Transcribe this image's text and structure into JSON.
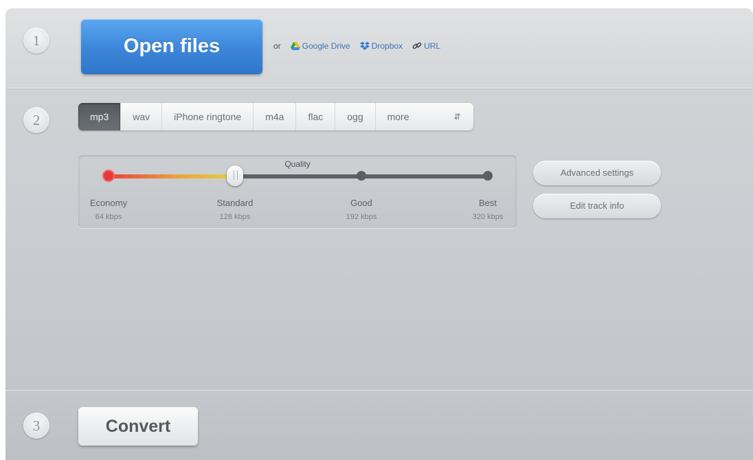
{
  "steps": [
    "1",
    "2",
    "3"
  ],
  "open": {
    "label": "Open files",
    "or": "or",
    "sources": [
      {
        "label": "Google Drive",
        "icon": "google-drive-icon"
      },
      {
        "label": "Dropbox",
        "icon": "dropbox-icon"
      },
      {
        "label": "URL",
        "icon": "link-icon"
      }
    ]
  },
  "formats": {
    "tabs": [
      "mp3",
      "wav",
      "iPhone ringtone",
      "m4a",
      "flac",
      "ogg",
      "more"
    ],
    "selected": "mp3"
  },
  "quality": {
    "label": "Quality",
    "selected_index": 1,
    "levels": [
      {
        "name": "Economy",
        "rate": "64 kbps"
      },
      {
        "name": "Standard",
        "rate": "128 kbps"
      },
      {
        "name": "Good",
        "rate": "192 kbps"
      },
      {
        "name": "Best",
        "rate": "320 kbps"
      }
    ]
  },
  "buttons": {
    "advanced": "Advanced settings",
    "edit_track": "Edit track info",
    "convert": "Convert"
  },
  "colors": {
    "accent": "#3c86da",
    "link": "#3a73b9",
    "active_tab": "#5b6066"
  }
}
